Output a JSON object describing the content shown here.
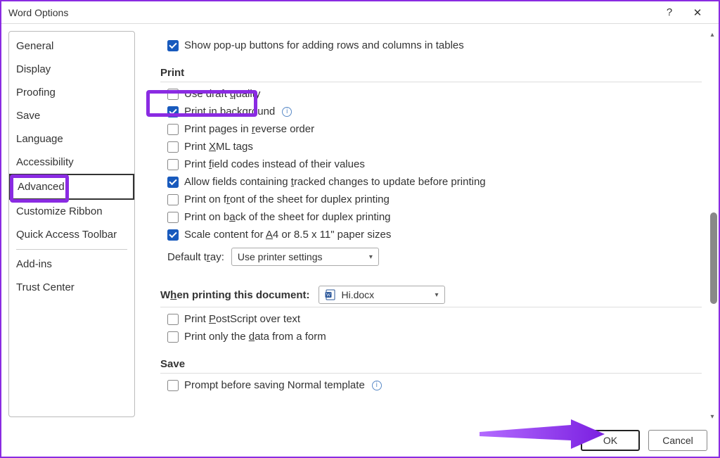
{
  "titlebar": {
    "title": "Word Options",
    "help_tooltip": "?",
    "close_tooltip": "✕"
  },
  "sidebar": {
    "items": [
      {
        "label": "General"
      },
      {
        "label": "Display"
      },
      {
        "label": "Proofing"
      },
      {
        "label": "Save"
      },
      {
        "label": "Language"
      },
      {
        "label": "Accessibility"
      },
      {
        "label": "Advanced",
        "selected": true
      },
      {
        "label": "Customize Ribbon"
      },
      {
        "label": "Quick Access Toolbar"
      }
    ],
    "items2": [
      {
        "label": "Add-ins"
      },
      {
        "label": "Trust Center"
      }
    ]
  },
  "content": {
    "top_option": {
      "label": "Show pop-up buttons for adding rows and columns in tables",
      "checked": true
    },
    "print_heading": "Print",
    "print_options": [
      {
        "key": "draft",
        "label_html": "Use draft <span class='und'>q</span>uality",
        "checked": false
      },
      {
        "key": "background",
        "label_html": "Print in <span class='und'>b</span>ackground",
        "checked": true,
        "info": true
      },
      {
        "key": "reverse",
        "label_html": "Print pages in <span class='und'>r</span>everse order",
        "checked": false
      },
      {
        "key": "xml",
        "label_html": "Print <span class='und'>X</span>ML tags",
        "checked": false
      },
      {
        "key": "fieldcodes",
        "label_html": "Print <span class='und'>f</span>ield codes instead of their values",
        "checked": false
      },
      {
        "key": "tracked",
        "label_html": "Allow fields containing <span class='und'>t</span>racked changes to update before printing",
        "checked": true
      },
      {
        "key": "front",
        "label_html": "Print on f<span class='und'>r</span>ont of the sheet for duplex printing",
        "checked": false
      },
      {
        "key": "back",
        "label_html": "Print on b<span class='und'>a</span>ck of the sheet for duplex printing",
        "checked": false
      },
      {
        "key": "scale",
        "label_html": "Scale content for <span class='und'>A</span>4 or 8.5 x 11\" paper sizes",
        "checked": true
      }
    ],
    "default_tray": {
      "label_html": "Default t<span class='und'>r</span>ay:",
      "value": "Use printer settings"
    },
    "doc_section": {
      "heading_html": "W<span class='und'>h</span>en printing this document:",
      "dropdown_value": "Hi.docx",
      "options": [
        {
          "key": "postscript",
          "label_html": "Print <span class='und'>P</span>ostScript over text",
          "checked": false
        },
        {
          "key": "formdata",
          "label_html": "Print only the <span class='und'>d</span>ata from a form",
          "checked": false
        }
      ]
    },
    "save_heading": "Save",
    "save_options": [
      {
        "key": "normal",
        "label_html": "Prompt before saving Normal template",
        "checked": false,
        "info": true
      }
    ]
  },
  "footer": {
    "ok": "OK",
    "cancel": "Cancel"
  }
}
